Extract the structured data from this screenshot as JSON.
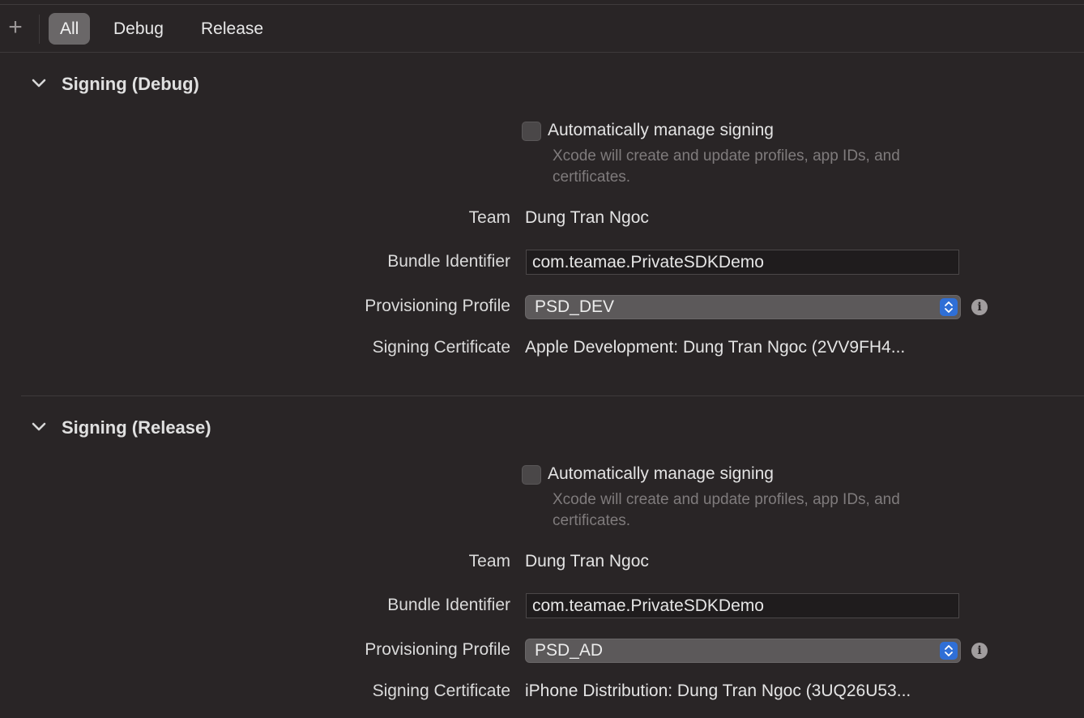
{
  "toolbar": {
    "add_glyph": "+",
    "segments": [
      "All",
      "Debug",
      "Release"
    ],
    "selected": "All"
  },
  "sections": [
    {
      "title": "Signing (Debug)",
      "auto_manage_label": "Automatically manage signing",
      "auto_manage_checked": false,
      "help_text": "Xcode will create and update profiles, app IDs, and certificates.",
      "team_label": "Team",
      "team_value": "Dung Tran Ngoc",
      "bundle_label": "Bundle Identifier",
      "bundle_value": "com.teamae.PrivateSDKDemo",
      "profile_label": "Provisioning Profile",
      "profile_value": "PSD_DEV",
      "cert_label": "Signing Certificate",
      "cert_value": "Apple Development: Dung Tran Ngoc (2VV9FH4..."
    },
    {
      "title": "Signing (Release)",
      "auto_manage_label": "Automatically manage signing",
      "auto_manage_checked": false,
      "help_text": "Xcode will create and update profiles, app IDs, and certificates.",
      "team_label": "Team",
      "team_value": "Dung Tran Ngoc",
      "bundle_label": "Bundle Identifier",
      "bundle_value": "com.teamae.PrivateSDKDemo",
      "profile_label": "Provisioning Profile",
      "profile_value": "PSD_AD",
      "cert_label": "Signing Certificate",
      "cert_value": "iPhone Distribution: Dung Tran Ngoc (3UQ26U53..."
    }
  ],
  "colors": {
    "background": "#292526",
    "accent": "#2f6fd6",
    "selected_segment": "#6a6768"
  },
  "icons": {
    "add": "plus-icon",
    "disclosure": "chevron-down-icon",
    "popup": "up-down-arrows-icon",
    "info": "info-icon"
  }
}
